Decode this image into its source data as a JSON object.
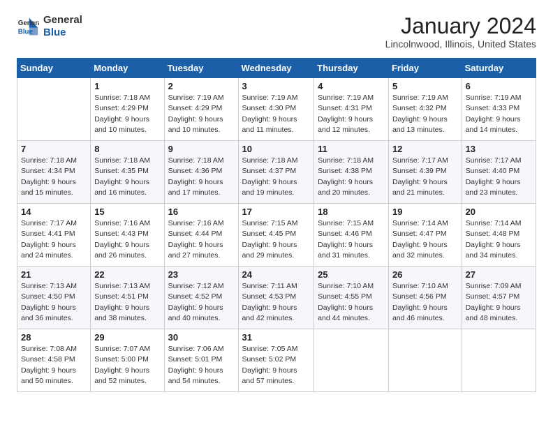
{
  "header": {
    "logo_line1": "General",
    "logo_line2": "Blue",
    "title": "January 2024",
    "location": "Lincolnwood, Illinois, United States"
  },
  "weekdays": [
    "Sunday",
    "Monday",
    "Tuesday",
    "Wednesday",
    "Thursday",
    "Friday",
    "Saturday"
  ],
  "weeks": [
    [
      {
        "day": "",
        "sunrise": "",
        "sunset": "",
        "daylight": ""
      },
      {
        "day": "1",
        "sunrise": "Sunrise: 7:18 AM",
        "sunset": "Sunset: 4:29 PM",
        "daylight": "Daylight: 9 hours and 10 minutes."
      },
      {
        "day": "2",
        "sunrise": "Sunrise: 7:19 AM",
        "sunset": "Sunset: 4:29 PM",
        "daylight": "Daylight: 9 hours and 10 minutes."
      },
      {
        "day": "3",
        "sunrise": "Sunrise: 7:19 AM",
        "sunset": "Sunset: 4:30 PM",
        "daylight": "Daylight: 9 hours and 11 minutes."
      },
      {
        "day": "4",
        "sunrise": "Sunrise: 7:19 AM",
        "sunset": "Sunset: 4:31 PM",
        "daylight": "Daylight: 9 hours and 12 minutes."
      },
      {
        "day": "5",
        "sunrise": "Sunrise: 7:19 AM",
        "sunset": "Sunset: 4:32 PM",
        "daylight": "Daylight: 9 hours and 13 minutes."
      },
      {
        "day": "6",
        "sunrise": "Sunrise: 7:19 AM",
        "sunset": "Sunset: 4:33 PM",
        "daylight": "Daylight: 9 hours and 14 minutes."
      }
    ],
    [
      {
        "day": "7",
        "sunrise": "Sunrise: 7:18 AM",
        "sunset": "Sunset: 4:34 PM",
        "daylight": "Daylight: 9 hours and 15 minutes."
      },
      {
        "day": "8",
        "sunrise": "Sunrise: 7:18 AM",
        "sunset": "Sunset: 4:35 PM",
        "daylight": "Daylight: 9 hours and 16 minutes."
      },
      {
        "day": "9",
        "sunrise": "Sunrise: 7:18 AM",
        "sunset": "Sunset: 4:36 PM",
        "daylight": "Daylight: 9 hours and 17 minutes."
      },
      {
        "day": "10",
        "sunrise": "Sunrise: 7:18 AM",
        "sunset": "Sunset: 4:37 PM",
        "daylight": "Daylight: 9 hours and 19 minutes."
      },
      {
        "day": "11",
        "sunrise": "Sunrise: 7:18 AM",
        "sunset": "Sunset: 4:38 PM",
        "daylight": "Daylight: 9 hours and 20 minutes."
      },
      {
        "day": "12",
        "sunrise": "Sunrise: 7:17 AM",
        "sunset": "Sunset: 4:39 PM",
        "daylight": "Daylight: 9 hours and 21 minutes."
      },
      {
        "day": "13",
        "sunrise": "Sunrise: 7:17 AM",
        "sunset": "Sunset: 4:40 PM",
        "daylight": "Daylight: 9 hours and 23 minutes."
      }
    ],
    [
      {
        "day": "14",
        "sunrise": "Sunrise: 7:17 AM",
        "sunset": "Sunset: 4:41 PM",
        "daylight": "Daylight: 9 hours and 24 minutes."
      },
      {
        "day": "15",
        "sunrise": "Sunrise: 7:16 AM",
        "sunset": "Sunset: 4:43 PM",
        "daylight": "Daylight: 9 hours and 26 minutes."
      },
      {
        "day": "16",
        "sunrise": "Sunrise: 7:16 AM",
        "sunset": "Sunset: 4:44 PM",
        "daylight": "Daylight: 9 hours and 27 minutes."
      },
      {
        "day": "17",
        "sunrise": "Sunrise: 7:15 AM",
        "sunset": "Sunset: 4:45 PM",
        "daylight": "Daylight: 9 hours and 29 minutes."
      },
      {
        "day": "18",
        "sunrise": "Sunrise: 7:15 AM",
        "sunset": "Sunset: 4:46 PM",
        "daylight": "Daylight: 9 hours and 31 minutes."
      },
      {
        "day": "19",
        "sunrise": "Sunrise: 7:14 AM",
        "sunset": "Sunset: 4:47 PM",
        "daylight": "Daylight: 9 hours and 32 minutes."
      },
      {
        "day": "20",
        "sunrise": "Sunrise: 7:14 AM",
        "sunset": "Sunset: 4:48 PM",
        "daylight": "Daylight: 9 hours and 34 minutes."
      }
    ],
    [
      {
        "day": "21",
        "sunrise": "Sunrise: 7:13 AM",
        "sunset": "Sunset: 4:50 PM",
        "daylight": "Daylight: 9 hours and 36 minutes."
      },
      {
        "day": "22",
        "sunrise": "Sunrise: 7:13 AM",
        "sunset": "Sunset: 4:51 PM",
        "daylight": "Daylight: 9 hours and 38 minutes."
      },
      {
        "day": "23",
        "sunrise": "Sunrise: 7:12 AM",
        "sunset": "Sunset: 4:52 PM",
        "daylight": "Daylight: 9 hours and 40 minutes."
      },
      {
        "day": "24",
        "sunrise": "Sunrise: 7:11 AM",
        "sunset": "Sunset: 4:53 PM",
        "daylight": "Daylight: 9 hours and 42 minutes."
      },
      {
        "day": "25",
        "sunrise": "Sunrise: 7:10 AM",
        "sunset": "Sunset: 4:55 PM",
        "daylight": "Daylight: 9 hours and 44 minutes."
      },
      {
        "day": "26",
        "sunrise": "Sunrise: 7:10 AM",
        "sunset": "Sunset: 4:56 PM",
        "daylight": "Daylight: 9 hours and 46 minutes."
      },
      {
        "day": "27",
        "sunrise": "Sunrise: 7:09 AM",
        "sunset": "Sunset: 4:57 PM",
        "daylight": "Daylight: 9 hours and 48 minutes."
      }
    ],
    [
      {
        "day": "28",
        "sunrise": "Sunrise: 7:08 AM",
        "sunset": "Sunset: 4:58 PM",
        "daylight": "Daylight: 9 hours and 50 minutes."
      },
      {
        "day": "29",
        "sunrise": "Sunrise: 7:07 AM",
        "sunset": "Sunset: 5:00 PM",
        "daylight": "Daylight: 9 hours and 52 minutes."
      },
      {
        "day": "30",
        "sunrise": "Sunrise: 7:06 AM",
        "sunset": "Sunset: 5:01 PM",
        "daylight": "Daylight: 9 hours and 54 minutes."
      },
      {
        "day": "31",
        "sunrise": "Sunrise: 7:05 AM",
        "sunset": "Sunset: 5:02 PM",
        "daylight": "Daylight: 9 hours and 57 minutes."
      },
      {
        "day": "",
        "sunrise": "",
        "sunset": "",
        "daylight": ""
      },
      {
        "day": "",
        "sunrise": "",
        "sunset": "",
        "daylight": ""
      },
      {
        "day": "",
        "sunrise": "",
        "sunset": "",
        "daylight": ""
      }
    ]
  ]
}
